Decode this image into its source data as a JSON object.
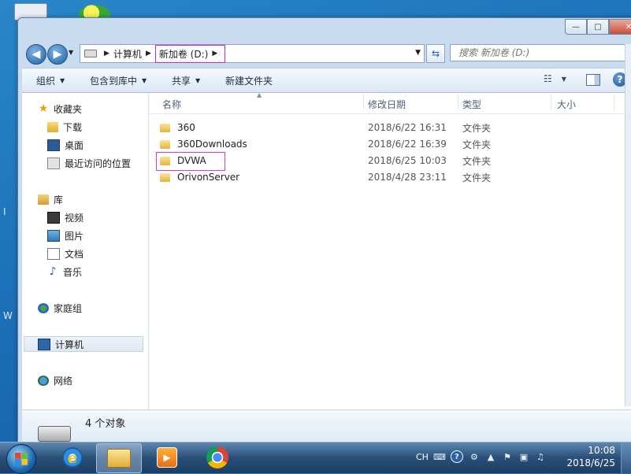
{
  "desktop": {
    "edge_text_1": "I",
    "edge_text_2": "W"
  },
  "window": {
    "caption": {
      "minimize": "—",
      "maximize": "□",
      "close": "✕"
    }
  },
  "address": {
    "crumbs": [
      "计算机",
      "新加卷 (D:)"
    ],
    "search_placeholder": "搜索 新加卷 (D:)"
  },
  "command_bar": {
    "organize": "组织",
    "include_in_library": "包含到库中",
    "share": "共享",
    "new_folder": "新建文件夹"
  },
  "nav_pane": {
    "favorites": "收藏夹",
    "downloads": "下载",
    "desktop": "桌面",
    "recent": "最近访问的位置",
    "libraries": "库",
    "videos": "视频",
    "pictures": "图片",
    "documents": "文档",
    "music": "音乐",
    "homegroup": "家庭组",
    "computer": "计算机",
    "network": "网络"
  },
  "columns": {
    "name": "名称",
    "modified": "修改日期",
    "type": "类型",
    "size": "大小"
  },
  "files": [
    {
      "name": "360",
      "modified": "2018/6/22 16:31",
      "type": "文件夹"
    },
    {
      "name": "360Downloads",
      "modified": "2018/6/22 16:39",
      "type": "文件夹"
    },
    {
      "name": "DVWA",
      "modified": "2018/6/25 10:03",
      "type": "文件夹"
    },
    {
      "name": "OrivonServer",
      "modified": "2018/4/28 23:11",
      "type": "文件夹"
    }
  ],
  "details": {
    "item_count": "4 个对象"
  },
  "taskbar": {
    "tray_lang": "CH",
    "clock_time": "10:08",
    "clock_date": "2018/6/25"
  },
  "colors": {
    "highlight_box": "#d43ad4",
    "taskbar": "#294f78",
    "nav_selected": "#dfe8f2"
  }
}
